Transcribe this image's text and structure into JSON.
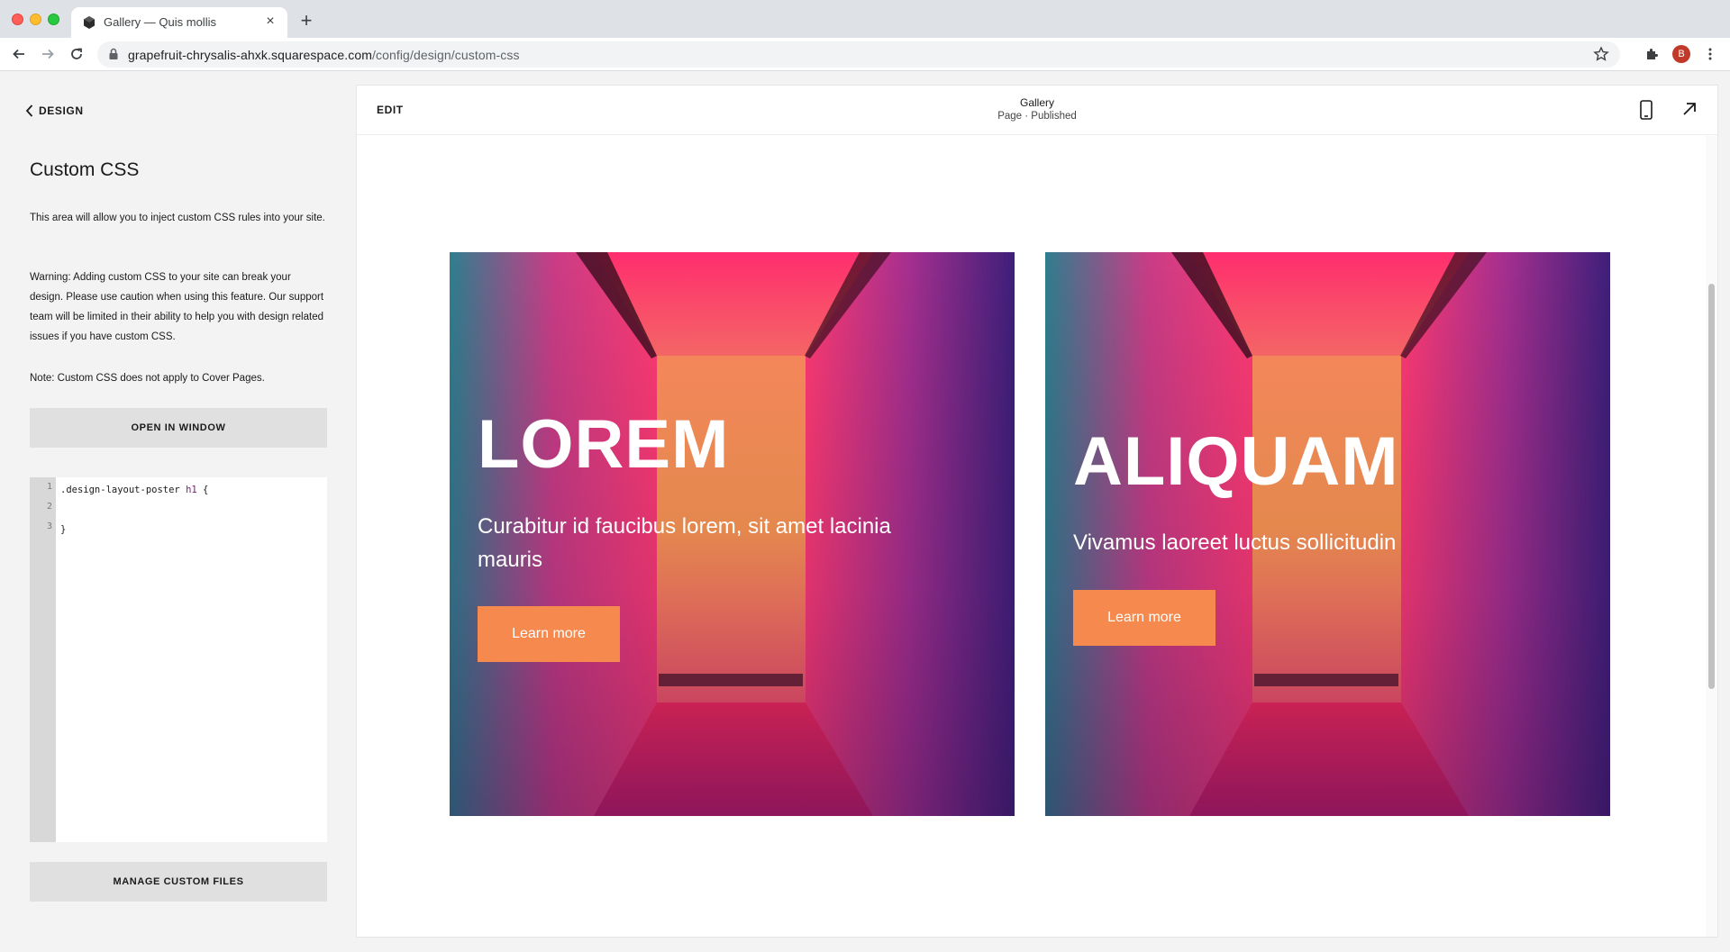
{
  "browser": {
    "tab_title": "Gallery — Quis mollis",
    "url_host": "grapefruit-chrysalis-ahxk.squarespace.com",
    "url_path": "/config/design/custom-css",
    "avatar_letter": "B"
  },
  "panel": {
    "back_label": "DESIGN",
    "title": "Custom CSS",
    "intro": "This area will allow you to inject custom CSS rules into your site.",
    "warning": "Warning: Adding custom CSS to your site can break your design. Please use caution when using this feature. Our support team will be limited in their ability to help you with design related issues if you have custom CSS.",
    "note": "Note: Custom CSS does not apply to Cover Pages.",
    "open_window_label": "OPEN IN WINDOW",
    "manage_files_label": "MANAGE CUSTOM FILES",
    "code_lines": [
      {
        "num": "1",
        "selector": ".design-layout-poster ",
        "tag": "h1",
        "brace": " {"
      },
      {
        "num": "2",
        "text": ""
      },
      {
        "num": "3",
        "text": "}"
      }
    ]
  },
  "frame": {
    "edit_label": "EDIT",
    "page_name": "Gallery",
    "page_status": "Page · Published"
  },
  "cards": [
    {
      "heading": "LOREM",
      "subtitle": "Curabitur id faucibus lorem, sit amet lacinia mauris",
      "button": "Learn more"
    },
    {
      "heading": "ALIQUAM",
      "subtitle": "Vivamus laoreet luctus sollicitudin",
      "button": "Learn more"
    }
  ],
  "colors": {
    "button_accent": "#f5894e",
    "image_pink": "#ff2d6e",
    "image_teal": "#3f8f99",
    "image_purple": "#4a1f8c"
  }
}
